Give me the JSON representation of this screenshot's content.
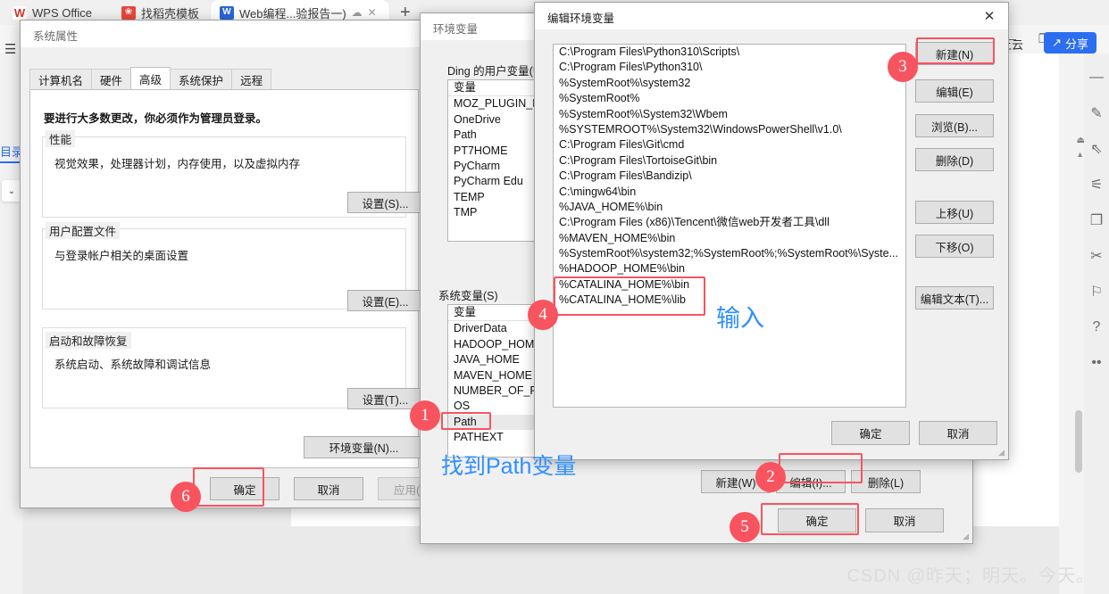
{
  "wps": {
    "tabs": [
      {
        "label": "WPS Office",
        "icon": "wps-logo-icon",
        "active": false
      },
      {
        "label": "找稻壳模板",
        "icon": "docer-logo-icon",
        "active": false
      },
      {
        "label": "Web编程...验报告一)",
        "icon": "writer-doc-icon",
        "active": true
      }
    ],
    "new_tab_label": "+",
    "window_controls": {
      "minimize": "—",
      "restore": "❐",
      "more": "⋮"
    },
    "cloud_status": "待上云",
    "share_label": "分享",
    "toc_label": "目录",
    "watermark": "CSDN @昨天；明天。今天。"
  },
  "system_properties": {
    "title": "系统属性",
    "tabs": [
      "计算机名",
      "硬件",
      "高级",
      "系统保护",
      "远程"
    ],
    "active_tab": "高级",
    "admin_notice": "要进行大多数更改，你必须作为管理员登录。",
    "groups": [
      {
        "title": "性能",
        "desc": "视觉效果，处理器计划，内存使用，以及虚拟内存",
        "button": "设置(S)..."
      },
      {
        "title": "用户配置文件",
        "desc": "与登录帐户相关的桌面设置",
        "button": "设置(E)..."
      },
      {
        "title": "启动和故障恢复",
        "desc": "系统启动、系统故障和调试信息",
        "button": "设置(T)..."
      }
    ],
    "env_button": "环境变量(N)...",
    "footer_buttons": {
      "ok": "确定",
      "cancel": "取消",
      "apply": "应用(A)"
    }
  },
  "environment_variables": {
    "title": "环境变量",
    "user_section_label": "Ding 的用户变量(U)",
    "user_column_header": "变量",
    "user_variables": [
      "MOZ_PLUGIN_PAT",
      "OneDrive",
      "Path",
      "PT7HOME",
      "PyCharm",
      "PyCharm Edu",
      "TEMP",
      "TMP"
    ],
    "system_section_label": "系统变量(S)",
    "system_column_header": "变量",
    "system_variables": [
      "DriverData",
      "HADOOP_HOME",
      "JAVA_HOME",
      "MAVEN_HOME",
      "NUMBER_OF_PRO",
      "OS",
      "Path",
      "PATHEXT"
    ],
    "selected_system_variable": "Path",
    "system_buttons": {
      "new": "新建(W)",
      "edit": "编辑(I)...",
      "delete": "删除(L)"
    },
    "footer_buttons": {
      "ok": "确定",
      "cancel": "取消"
    }
  },
  "edit_environment_variable": {
    "title": "编辑环境变量",
    "entries": [
      "C:\\Program Files\\Python310\\Scripts\\",
      "C:\\Program Files\\Python310\\",
      "%SystemRoot%\\system32",
      "%SystemRoot%",
      "%SystemRoot%\\System32\\Wbem",
      "%SYSTEMROOT%\\System32\\WindowsPowerShell\\v1.0\\",
      "C:\\Program Files\\Git\\cmd",
      "C:\\Program Files\\TortoiseGit\\bin",
      "C:\\Program Files\\Bandizip\\",
      "C:\\mingw64\\bin",
      "%JAVA_HOME%\\bin",
      "C:\\Program Files (x86)\\Tencent\\微信web开发者工具\\dll",
      "%MAVEN_HOME%\\bin",
      "%SystemRoot%\\system32;%SystemRoot%;%SystemRoot%\\Syste...",
      "%HADOOP_HOME%\\bin",
      "%CATALINA_HOME%\\bin",
      "%CATALINA_HOME%\\lib"
    ],
    "highlighted_entries": [
      "%CATALINA_HOME%\\bin",
      "%CATALINA_HOME%\\lib"
    ],
    "side_buttons": [
      "新建(N)",
      "编辑(E)",
      "浏览(B)...",
      "删除(D)",
      "上移(U)",
      "下移(O)",
      "编辑文本(T)..."
    ],
    "footer_buttons": {
      "ok": "确定",
      "cancel": "取消"
    }
  },
  "annotations": {
    "markers": [
      {
        "id": "1",
        "number": "1"
      },
      {
        "id": "2",
        "number": "2"
      },
      {
        "id": "3",
        "number": "3"
      },
      {
        "id": "4",
        "number": "4"
      },
      {
        "id": "5",
        "number": "5"
      },
      {
        "id": "6",
        "number": "6"
      }
    ],
    "notes": [
      {
        "id": "input-note",
        "text": "输入"
      },
      {
        "id": "find-path-note",
        "text": "找到Path变量"
      }
    ],
    "accent_color": "#f8545f",
    "note_color": "#2f8fff"
  }
}
